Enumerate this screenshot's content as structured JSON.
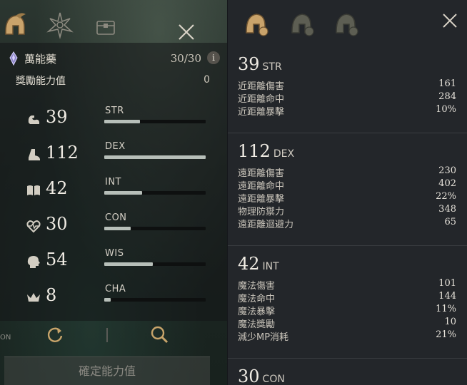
{
  "left_panel": {
    "potion": {
      "name": "萬能藥",
      "count": "30/30",
      "info": "i"
    },
    "reward": {
      "label": "獎勵能力值",
      "value": "0"
    },
    "stats": [
      {
        "icon": "arm-icon",
        "value": "39",
        "name": "STR",
        "fill": 0.35
      },
      {
        "icon": "boot-icon",
        "value": "112",
        "name": "DEX",
        "fill": 1.0
      },
      {
        "icon": "book-icon",
        "value": "42",
        "name": "INT",
        "fill": 0.37
      },
      {
        "icon": "heart-icon",
        "value": "30",
        "name": "CON",
        "fill": 0.26
      },
      {
        "icon": "head-icon",
        "value": "54",
        "name": "WIS",
        "fill": 0.48
      },
      {
        "icon": "crown-icon",
        "value": "8",
        "name": "CHA",
        "fill": 0.06
      }
    ],
    "on_label": "ON",
    "confirm_label": "確定能力值"
  },
  "right_panel": {
    "sections": [
      {
        "value": "39",
        "name": "STR",
        "rows": [
          {
            "label": "近距離傷害",
            "value": "161"
          },
          {
            "label": "近距離命中",
            "value": "284"
          },
          {
            "label": "近距離暴擊",
            "value": "10%"
          }
        ]
      },
      {
        "value": "112",
        "name": "DEX",
        "rows": [
          {
            "label": "遠距離傷害",
            "value": "230"
          },
          {
            "label": "遠距離命中",
            "value": "402"
          },
          {
            "label": "遠距離暴擊",
            "value": "22%"
          },
          {
            "label": "物理防禦力",
            "value": "348"
          },
          {
            "label": "遠距離迴避力",
            "value": "65"
          }
        ]
      },
      {
        "value": "42",
        "name": "INT",
        "rows": [
          {
            "label": "魔法傷害",
            "value": "101"
          },
          {
            "label": "魔法命中",
            "value": "144"
          },
          {
            "label": "魔法暴擊",
            "value": "11%"
          },
          {
            "label": "魔法獎勵",
            "value": "10"
          },
          {
            "label": "減少MP消耗",
            "value": "21%"
          }
        ]
      },
      {
        "value": "30",
        "name": "CON",
        "rows": []
      }
    ]
  },
  "colors": {
    "accent": "#c8a46a",
    "bar_fill": "#b7bfb9",
    "panel_right": "#23262a"
  }
}
